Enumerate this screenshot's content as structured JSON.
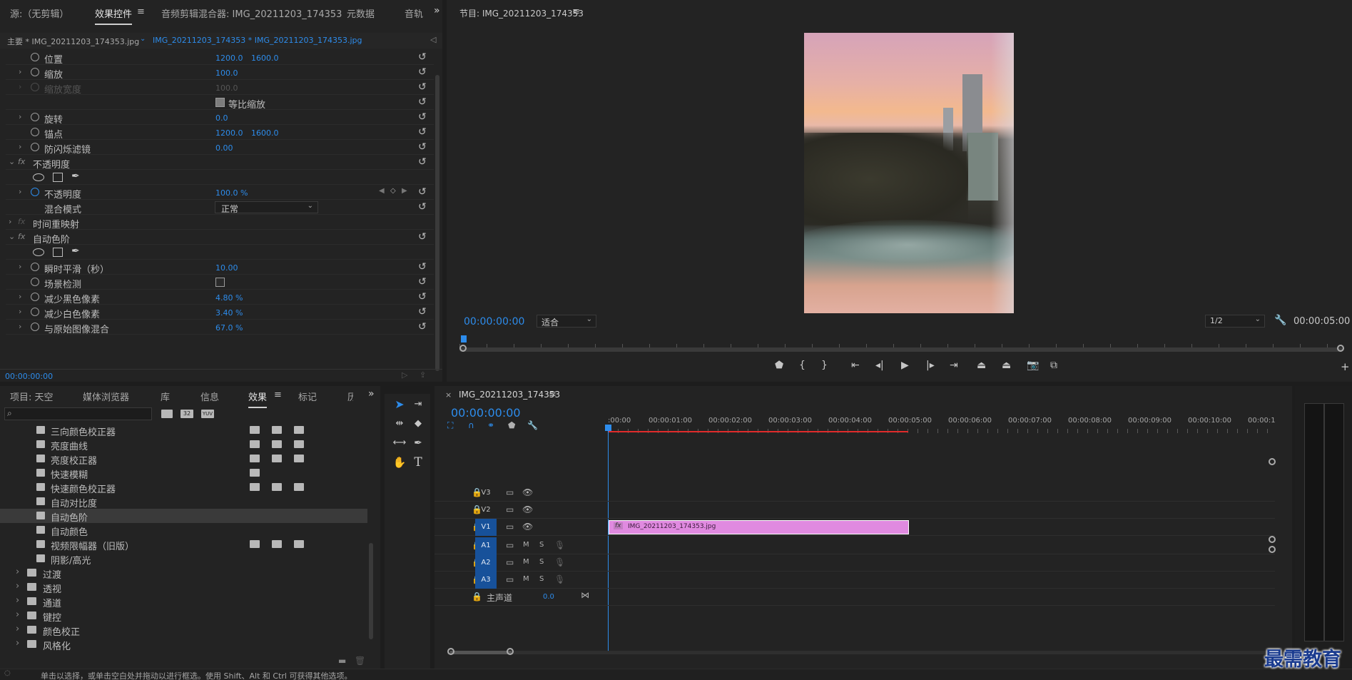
{
  "effect_controls": {
    "tabs": [
      "源:（无剪辑）",
      "效果控件",
      "音频剪辑混合器: IMG_20211203_174353",
      "元数据",
      "音轨"
    ],
    "clip_tab_master": "主要 * IMG_20211203_174353.jpg",
    "clip_tab_sequence": "IMG_20211203_174353 * IMG_20211203_174353.jpg",
    "props": {
      "position": {
        "label": "位置",
        "v1": "1200.0",
        "v2": "1600.0"
      },
      "scale": {
        "label": "缩放",
        "v1": "100.0"
      },
      "scale_width": {
        "label": "缩放宽度",
        "v1": "100.0"
      },
      "uniform_scale": {
        "label": "等比缩放"
      },
      "rotation": {
        "label": "旋转",
        "v1": "0.0"
      },
      "anchor": {
        "label": "锚点",
        "v1": "1200.0",
        "v2": "1600.0"
      },
      "flicker": {
        "label": "防闪烁滤镜",
        "v1": "0.00"
      },
      "opacity_group": {
        "label": "不透明度"
      },
      "opacity": {
        "label": "不透明度",
        "v1": "100.0 %"
      },
      "blend": {
        "label": "混合模式",
        "v1": "正常"
      },
      "time_remap": {
        "label": "时间重映射"
      },
      "auto_levels": {
        "label": "自动色阶"
      },
      "temporal_smoothing": {
        "label": "瞬时平滑（秒）",
        "v1": "10.00"
      },
      "scene_detect": {
        "label": "场景检测"
      },
      "black_clip": {
        "label": "减少黑色像素",
        "v1": "4.80 %"
      },
      "white_clip": {
        "label": "减少白色像素",
        "v1": "3.40 %"
      },
      "blend_original": {
        "label": "与原始图像混合",
        "v1": "67.0 %"
      }
    },
    "timecode": "00:00:00:00"
  },
  "program": {
    "title": "节目: IMG_20211203_174353",
    "timecode": "00:00:00:00",
    "fit": "适合",
    "resolution": "1/2",
    "duration": "00:00:05:00"
  },
  "project": {
    "tabs": [
      "项目: 天空",
      "媒体浏览器",
      "库",
      "信息",
      "效果",
      "标记",
      "历"
    ],
    "badges": [
      "32",
      "YUV"
    ],
    "effects": [
      {
        "label": "三向颜色校正器",
        "badges": 3
      },
      {
        "label": "亮度曲线",
        "badges": 3
      },
      {
        "label": "亮度校正器",
        "badges": 3
      },
      {
        "label": "快速模糊",
        "badges": 1
      },
      {
        "label": "快速颜色校正器",
        "badges": 3
      },
      {
        "label": "自动对比度",
        "badges": 0
      },
      {
        "label": "自动色阶",
        "badges": 0,
        "selected": true
      },
      {
        "label": "自动颜色",
        "badges": 0
      },
      {
        "label": "视频限幅器（旧版）",
        "badges": 3
      },
      {
        "label": "阴影/高光",
        "badges": 0
      }
    ],
    "folders": [
      "过渡",
      "透视",
      "通道",
      "键控",
      "颜色校正",
      "风格化"
    ]
  },
  "timeline": {
    "tab": "IMG_20211203_174353",
    "timecode": "00:00:00:00",
    "ruler": [
      ":00:00",
      "00:00:01:00",
      "00:00:02:00",
      "00:00:03:00",
      "00:00:04:00",
      "00:00:05:00",
      "00:00:06:00",
      "00:00:07:00",
      "00:00:08:00",
      "00:00:09:00",
      "00:00:10:00",
      "00:00:1"
    ],
    "video_tracks": [
      "V3",
      "V2",
      "V1"
    ],
    "audio_tracks": [
      "A1",
      "A2",
      "A3"
    ],
    "m": "M",
    "s": "S",
    "master_label": "主声道",
    "master_value": "0.0",
    "clip_name": "IMG_20211203_174353.jpg",
    "clip_fx": "fx"
  },
  "status": "单击以选择，或单击空白处并拖动以进行框选。使用 Shift、Alt 和 Ctrl 可获得其他选项。",
  "watermark": "最需教育",
  "colors": {
    "accent": "#2d8ceb",
    "clip": "#e08ae0",
    "track_selected": "#17519a",
    "workarea": "#e02b2b"
  }
}
